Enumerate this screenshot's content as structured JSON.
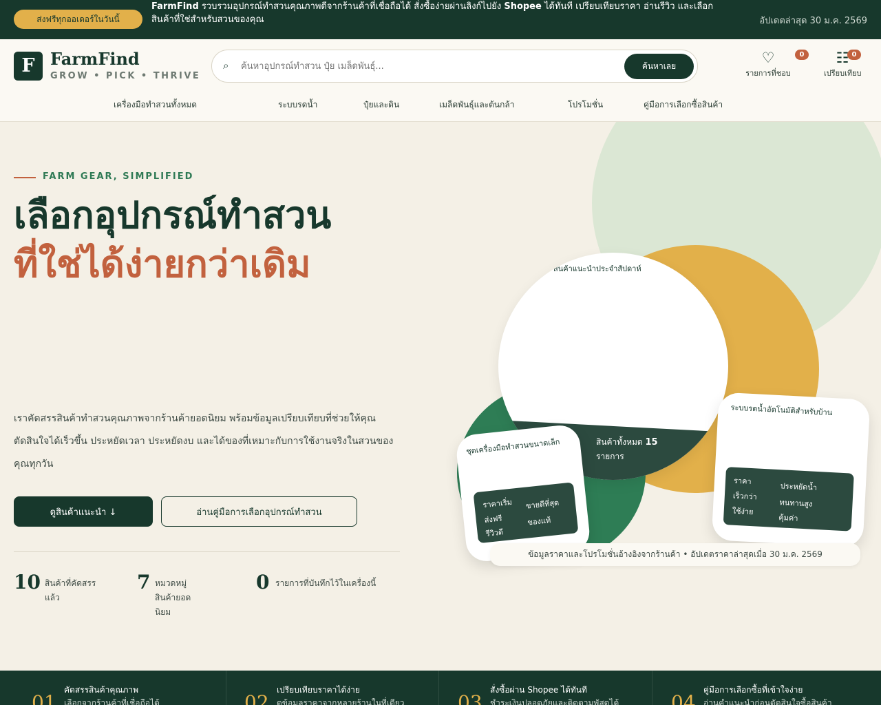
{
  "topbar": {
    "badge": "ส่งฟรีทุกออเดอร์ในวันนี้",
    "brand": "FarmFind",
    "message_a": "รวบรวมอุปกรณ์ทำสวนคุณภาพดีจากร้านค้าที่เชื่อถือได้ สั่งซื้อง่ายผ่านลิงก์ไปยัง",
    "shopee": "Shopee",
    "message_b": "ได้ทันที เปรียบเทียบราคา อ่านรีวิว และเลือกสินค้าที่ใช่สำหรับสวนของคุณ",
    "date": "อัปเดตล่าสุด 30 ม.ค. 2569"
  },
  "header": {
    "logo_letter": "F",
    "brand": "FarmFind",
    "tagline": "GROW • PICK • THRIVE",
    "search_placeholder": "ค้นหาอุปกรณ์ทำสวน ปุ๋ย เมล็ดพันธุ์...",
    "search_button": "ค้นหาเลย",
    "wishlist_label": "รายการที่ชอบ",
    "wishlist_count": "0",
    "compare_label": "เปรียบเทียบ",
    "compare_count": "0",
    "nav": [
      "เครื่องมือทำสวนทั้งหมด",
      "ระบบรดน้ำ",
      "ปุ๋ยและดิน",
      "เมล็ดพันธุ์และต้นกล้า",
      "โปรโมชั่น",
      "คู่มือการเลือกซื้อสินค้า"
    ]
  },
  "hero": {
    "eyebrow": "FARM GEAR, SIMPLIFIED",
    "headline_1": "เลือกอุปกรณ์ทำสวน",
    "headline_2": "ที่ใช่ได้ง่ายกว่าเดิม",
    "intro": "เราคัดสรรสินค้าทำสวนคุณภาพจากร้านค้ายอดนิยม พร้อมข้อมูลเปรียบเทียบที่ช่วยให้คุณตัดสินใจได้เร็วขึ้น ประหยัดเวลา ประหยัดงบ และได้ของที่เหมาะกับการใช้งานจริงในสวนของคุณทุกวัน",
    "primary_button": "ดูสินค้าแนะนำ ↓",
    "secondary_button": "อ่านคู่มือการเลือกอุปกรณ์ทำสวน",
    "stats": [
      {
        "value": "10",
        "label": "สินค้าที่คัดสรรแล้ว"
      },
      {
        "value": "7",
        "label": "หมวดหมู่สินค้ายอดนิยม"
      },
      {
        "value": "0",
        "label": "รายการที่บันทึกไว้ในเครื่องนี้"
      }
    ],
    "main_caption": "สินค้าแนะนำประจำสัปดาห์",
    "main_ribbon_label": "สินค้าทั้งหมด",
    "main_ribbon_value": "15",
    "main_ribbon_sub": "รายการ",
    "card1_caption": "ชุดเครื่องมือทำสวนขนาดเล็ก",
    "card1_panel": [
      "ราคาเริ่ม",
      "ส่งฟรี",
      "รีวิวดี",
      "ขายดีที่สุด",
      "ของแท้"
    ],
    "card2_caption": "ระบบรดน้ำอัตโนมัติสำหรับบ้าน",
    "card2_panel": [
      "ราคา",
      "เร็วกว่า",
      "ใช้ง่าย",
      "ประหยัดน้ำ",
      "ทนทานสูง",
      "คุ้มค่า"
    ],
    "caption_pill": "ข้อมูลราคาและโปรโมชั่นอ้างอิงจากร้านค้า • อัปเดตราคาล่าสุดเมื่อ 30 ม.ค. 2569"
  },
  "features": [
    {
      "num": "01",
      "title": "คัดสรรสินค้าคุณภาพ",
      "sub": "เลือกจากร้านค้าที่เชื่อถือได้"
    },
    {
      "num": "02",
      "title": "เปรียบเทียบราคาได้ง่าย",
      "sub": "ดูข้อมูลราคาจากหลายร้านในที่เดียว"
    },
    {
      "num": "03",
      "title": "สั่งซื้อผ่าน Shopee ได้ทันที",
      "sub": "ชำระเงินปลอดภัยและติดตามพัสดุได้"
    },
    {
      "num": "04",
      "title": "คู่มือการเลือกซื้อที่เข้าใจง่าย",
      "sub": "อ่านคำแนะนำก่อนตัดสินใจซื้อสินค้า"
    }
  ],
  "colors": {
    "dark_green": "#17382c",
    "gold": "#e2b04a",
    "terracotta": "#c2613e",
    "leaf_green": "#2e7d55",
    "sage": "#dbe7d4",
    "cream": "#f4f0e6"
  }
}
